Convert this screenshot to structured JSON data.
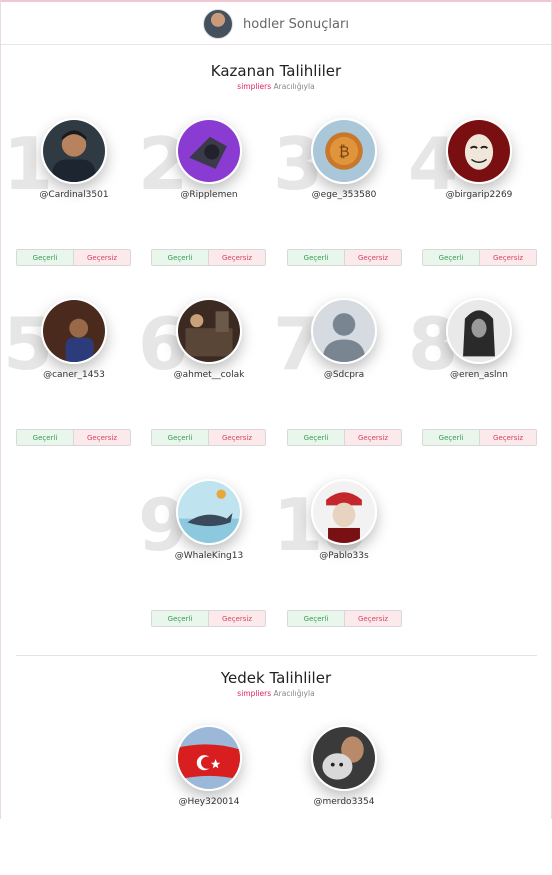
{
  "header": {
    "title": "hodler Sonuçları"
  },
  "winners": {
    "title": "Kazanan Talihliler",
    "sub_brand": "simpliers",
    "sub_text": "Aracılığıyla",
    "vote_ok": "Geçerli",
    "vote_no": "Geçersiz",
    "items": [
      {
        "num": "1",
        "user": "@Cardinal3501"
      },
      {
        "num": "2",
        "user": "@Ripplemen"
      },
      {
        "num": "3",
        "user": "@ege_353580"
      },
      {
        "num": "4",
        "user": "@birgarip2269"
      },
      {
        "num": "5",
        "user": "@caner_1453"
      },
      {
        "num": "6",
        "user": "@ahmet__colak"
      },
      {
        "num": "7",
        "user": "@Sdcpra"
      },
      {
        "num": "8",
        "user": "@eren_aslnn"
      },
      {
        "num": "9",
        "user": "@WhaleKing13"
      },
      {
        "num": "10",
        "user": "@Pablo33s"
      }
    ]
  },
  "backups": {
    "title": "Yedek Talihliler",
    "sub_brand": "simpliers",
    "sub_text": "Aracılığıyla",
    "items": [
      {
        "user": "@Hey320014"
      },
      {
        "user": "@merdo3354"
      }
    ]
  },
  "colors": {
    "accent": "#e0245e",
    "valid": "#3a9a55",
    "invalid": "#d6455f"
  }
}
